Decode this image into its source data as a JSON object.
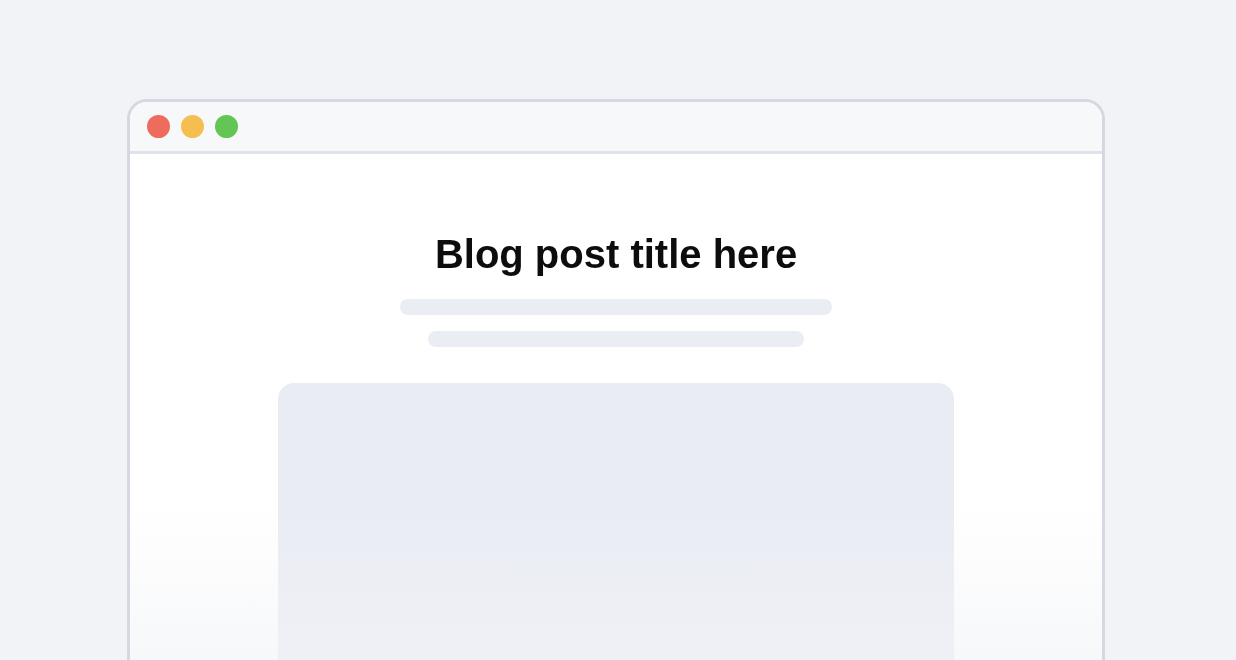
{
  "window": {
    "controls": [
      {
        "color": "#ee6b5e"
      },
      {
        "color": "#f5bf4f"
      },
      {
        "color": "#62c554"
      }
    ]
  },
  "article": {
    "title": "Blog post title here"
  }
}
